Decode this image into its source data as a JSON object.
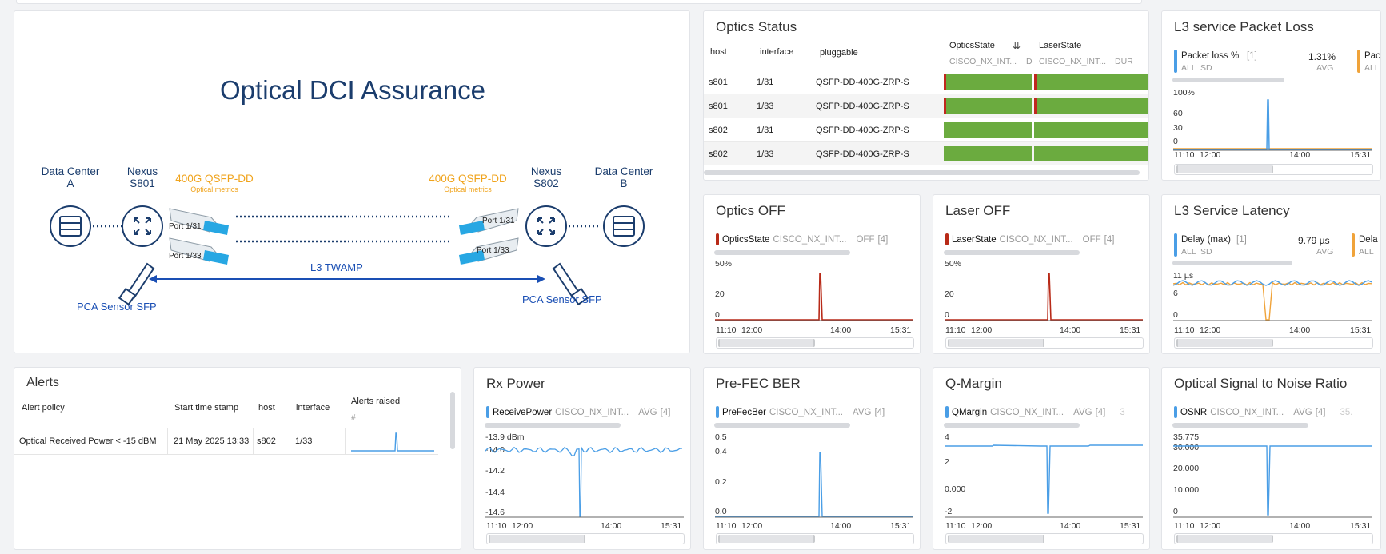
{
  "diagram": {
    "title": "Optical DCI Assurance",
    "dc_a": [
      "Data Center",
      "A"
    ],
    "nexus_a": [
      "Nexus",
      "S801"
    ],
    "qsfp_a": "400G QSFP-DD",
    "metrics_a": "Optical metrics",
    "qsfp_b": "400G QSFP-DD",
    "metrics_b": "Optical metrics",
    "nexus_b": [
      "Nexus",
      "S802"
    ],
    "dc_b": [
      "Data Center",
      "B"
    ],
    "port_a1": "Port 1/31",
    "port_a2": "Port 1/33",
    "port_b1": "Port 1/31",
    "port_b2": "Port 1/33",
    "twamp": "L3 TWAMP",
    "pca_a": "PCA Sensor SFP",
    "pca_b": "PCA Sensor SFP",
    "colors": {
      "navy": "#1b3d6d",
      "blue": "#1a4fb4",
      "orange": "#f0a41d",
      "cyan": "#27a7e3"
    }
  },
  "optics_status": {
    "title": "Optics Status",
    "headers": [
      "host",
      "interface",
      "pluggable",
      "OpticsState",
      "LaserState"
    ],
    "sub": [
      "CISCO_NX_INT...",
      "D",
      "CISCO_NX_INT...",
      "DUR"
    ],
    "rows": [
      {
        "host": "s801",
        "interface": "1/31",
        "pluggable": "QSFP-DD-400G-ZRP-S",
        "red": true
      },
      {
        "host": "s801",
        "interface": "1/33",
        "pluggable": "QSFP-DD-400G-ZRP-S",
        "red": true
      },
      {
        "host": "s802",
        "interface": "1/31",
        "pluggable": "QSFP-DD-400G-ZRP-S",
        "red": false
      },
      {
        "host": "s802",
        "interface": "1/33",
        "pluggable": "QSFP-DD-400G-ZRP-S",
        "red": false
      }
    ],
    "colors": {
      "ok": "#6bab3f",
      "bad": "#c0281f"
    }
  },
  "packet_loss": {
    "title": "L3 service Packet Loss",
    "legend_name": "Packet loss %",
    "legend_count": "[1]",
    "legend_sub1": "ALL",
    "legend_sub2": "SD",
    "value": "1.31%",
    "agg": "AVG",
    "legend2": "Pac",
    "legend2_sub": "ALL",
    "yticks": [
      "100%",
      "60",
      "30",
      "0"
    ],
    "xticks": [
      "11:10",
      "12:00",
      "14:00",
      "15:31"
    ]
  },
  "optics_off": {
    "title": "Optics OFF",
    "legend_name": "OpticsState",
    "legend_src": "CISCO_NX_INT...",
    "legend_agg": "OFF",
    "legend_count": "[4]",
    "yticks": [
      "50%",
      "20",
      "0"
    ],
    "xticks": [
      "11:10",
      "12:00",
      "14:00",
      "15:31"
    ]
  },
  "laser_off": {
    "title": "Laser OFF",
    "legend_name": "LaserState",
    "legend_src": "CISCO_NX_INT...",
    "legend_agg": "OFF",
    "legend_count": "[4]",
    "yticks": [
      "50%",
      "20",
      "0"
    ],
    "xticks": [
      "11:10",
      "12:00",
      "14:00",
      "15:31"
    ]
  },
  "latency": {
    "title": "L3 Service Latency",
    "legend_name": "Delay (max)",
    "legend_count": "[1]",
    "legend_sub1": "ALL",
    "legend_sub2": "SD",
    "value": "9.79 µs",
    "agg": "AVG",
    "legend2": "Dela",
    "legend2_sub": "ALL",
    "yticks": [
      "11 µs",
      "6",
      "0"
    ],
    "xticks": [
      "11:10",
      "12:00",
      "14:00",
      "15:31"
    ]
  },
  "alerts": {
    "title": "Alerts",
    "headers": [
      "Alert policy",
      "Start time stamp",
      "host",
      "interface",
      "Alerts raised"
    ],
    "hash": "#",
    "rows": [
      {
        "policy": "Optical Received Power < -15 dBM",
        "start": "21 May 2025 13:33",
        "host": "s802",
        "interface": "1/33"
      }
    ]
  },
  "rx_power": {
    "title": "Rx Power",
    "legend_name": "ReceivePower",
    "legend_src": "CISCO_NX_INT...",
    "legend_agg": "AVG",
    "legend_count": "[4]",
    "yticks": [
      "-13.9 dBm",
      "-14.0",
      "-14.2",
      "-14.4",
      "-14.6"
    ],
    "xticks": [
      "11:10",
      "12:00",
      "14:00",
      "15:31"
    ]
  },
  "prefec": {
    "title": "Pre-FEC BER",
    "legend_name": "PreFecBer",
    "legend_src": "CISCO_NX_INT...",
    "legend_agg": "AVG",
    "legend_count": "[4]",
    "yticks": [
      "0.5",
      "0.4",
      "0.2",
      "0.0"
    ],
    "xticks": [
      "11:10",
      "12:00",
      "14:00",
      "15:31"
    ]
  },
  "qmargin": {
    "title": "Q-Margin",
    "legend_name": "QMargin",
    "legend_src": "CISCO_NX_INT...",
    "legend_agg": "AVG",
    "legend_count": "[4]",
    "legend_extra": "3",
    "yticks": [
      "4",
      "2",
      "0.000",
      "-2"
    ],
    "xticks": [
      "11:10",
      "12:00",
      "14:00",
      "15:31"
    ]
  },
  "osnr": {
    "title": "Optical Signal to Noise Ratio",
    "legend_name": "OSNR",
    "legend_src": "CISCO_NX_INT...",
    "legend_agg": "AVG",
    "legend_count": "[4]",
    "legend_extra": "35.",
    "yticks": [
      "35.775",
      "30.000",
      "20.000",
      "10.000",
      "0"
    ],
    "xticks": [
      "11:10",
      "12:00",
      "14:00",
      "15:31"
    ]
  },
  "colors": {
    "blue": "#4a9ee6",
    "orange": "#f0a33a",
    "red": "#b82a18",
    "green": "#6bab3f"
  }
}
